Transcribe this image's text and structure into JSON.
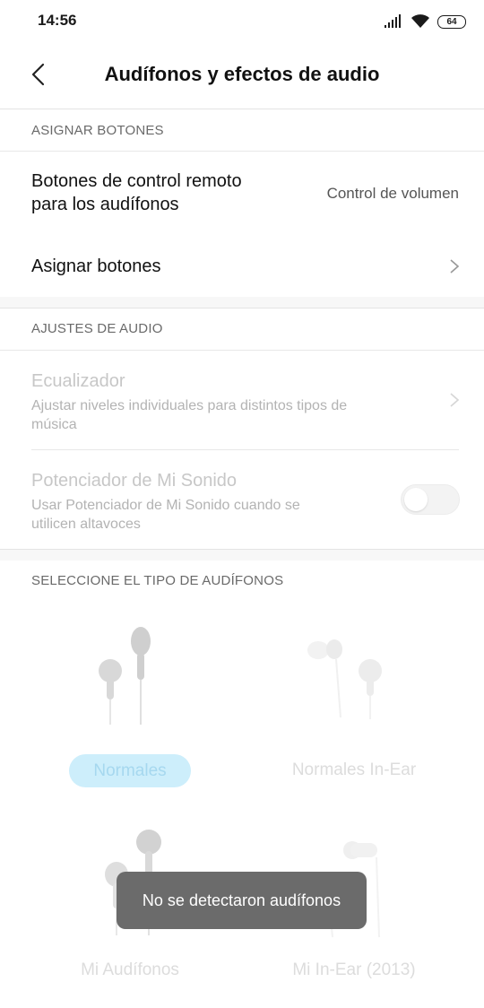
{
  "status_bar": {
    "time": "14:56",
    "battery": "64",
    "icons": [
      "signal-icon",
      "wifi-icon",
      "battery-icon"
    ]
  },
  "header": {
    "title": "Audífonos y efectos de audio",
    "back_icon": "back-arrow-icon"
  },
  "sections": {
    "assign": {
      "header": "ASIGNAR BOTONES",
      "remote_title_line1": "Botones de control remoto",
      "remote_title_line2": "para los audífonos",
      "remote_value": "Control de volumen",
      "assign_buttons": "Asignar botones"
    },
    "audio": {
      "header": "AJUSTES DE AUDIO",
      "equalizer_title": "Ecualizador",
      "equalizer_sub_line1": "Ajustar niveles individuales para distintos tipos de",
      "equalizer_sub_line2": "música",
      "booster_title": "Potenciador de Mi Sonido",
      "booster_sub_line1": "Usar Potenciador de Mi Sonido cuando se",
      "booster_sub_line2": "utilicen altavoces",
      "booster_enabled": false
    },
    "headphones": {
      "header": "SELECCIONE EL TIPO DE AUDÍFONOS",
      "options": [
        "Normales",
        "Normales In-Ear",
        "Mi Audífonos",
        "Mi In-Ear (2013)"
      ],
      "selected": "Normales"
    }
  },
  "toast": "No se detectaron audífonos",
  "colors": {
    "selected_pill": "#cdeefb",
    "toast_bg": "#6b6b6b",
    "divider": "#e3e3e3"
  }
}
